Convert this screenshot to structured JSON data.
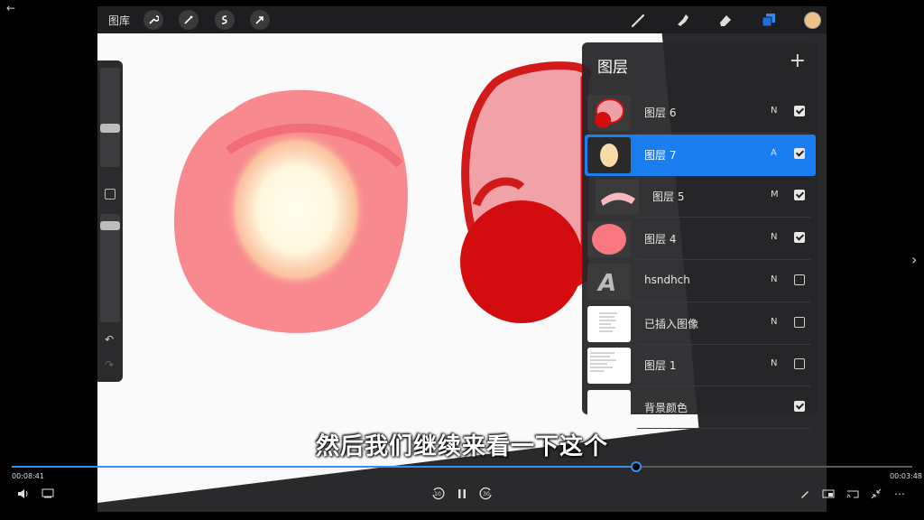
{
  "toolbar": {
    "gallery_label": "图库",
    "icons": [
      "wrench-icon",
      "magic-wand-icon",
      "selection-icon",
      "transform-arrow-icon",
      "brush-icon",
      "smudge-icon",
      "eraser-icon",
      "layers-icon",
      "color-swatch"
    ],
    "color_swatch": "#f1c08a"
  },
  "layers": {
    "title": "图层",
    "add_label": "+",
    "items": [
      {
        "name": "图层 6",
        "mode": "N",
        "visible": true,
        "active": false
      },
      {
        "name": "图层 7",
        "mode": "A",
        "visible": true,
        "active": true
      },
      {
        "name": "图层 5",
        "mode": "M",
        "visible": true,
        "active": false
      },
      {
        "name": "图层 4",
        "mode": "N",
        "visible": true,
        "active": false
      },
      {
        "name": "hsndhch",
        "mode": "N",
        "visible": false,
        "active": false
      },
      {
        "name": "已插入图像",
        "mode": "N",
        "visible": false,
        "active": false
      },
      {
        "name": "图层 1",
        "mode": "N",
        "visible": false,
        "active": false
      },
      {
        "name": "背景颜色",
        "mode": "",
        "visible": true,
        "active": false
      }
    ],
    "text_layer_glyph": "A"
  },
  "subtitle": "然后我们继续来看一下这个",
  "player": {
    "elapsed": "00:08:41",
    "duration": "00:03:48",
    "progress_fraction": 0.693,
    "skip_back_label": "10",
    "skip_forward_label": "30",
    "accent": "#3b8ef0"
  }
}
